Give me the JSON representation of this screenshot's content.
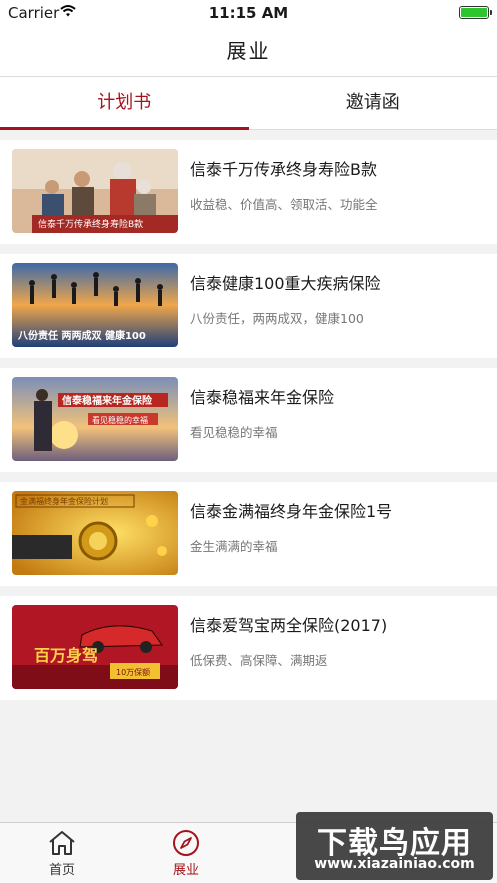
{
  "status_bar": {
    "carrier": "Carrier",
    "time": "11:15 AM",
    "wifi_icon": "wifi-icon",
    "battery_icon": "battery-icon"
  },
  "nav": {
    "title": "展业"
  },
  "tabs": [
    {
      "label": "计划书",
      "active": true
    },
    {
      "label": "邀请函",
      "active": false
    }
  ],
  "products": [
    {
      "title": "信泰千万传承终身寿险B款",
      "desc": "收益稳、价值高、领取活、功能全",
      "thumb_text": "信泰千万传承终身寿险B款"
    },
    {
      "title": "信泰健康100重大疾病保险",
      "desc": "八份责任，两两成双，健康100",
      "thumb_text": "八份责任 两两成双 健康100"
    },
    {
      "title": "信泰稳福来年金保险",
      "desc": "看见稳稳的幸福",
      "thumb_text": "信泰稳福来年金保险",
      "thumb_sub": "看见稳稳的幸福"
    },
    {
      "title": "信泰金满福终身年金保险1号",
      "desc": "金生满满的幸福",
      "thumb_text": "金满福终身年金保险计划"
    },
    {
      "title": "信泰爱驾宝两全保险(2017)",
      "desc": "低保费、高保障、满期返",
      "thumb_text": "百万身驾",
      "thumb_sub": "10万保额"
    }
  ],
  "tab_bar": [
    {
      "label": "首页",
      "icon": "home-icon",
      "active": false
    },
    {
      "label": "展业",
      "icon": "compass-icon",
      "active": true
    }
  ],
  "watermark": {
    "title": "下载鸟应用",
    "url": "www.xiazainiao.com"
  },
  "colors": {
    "accent": "#a5141c"
  }
}
